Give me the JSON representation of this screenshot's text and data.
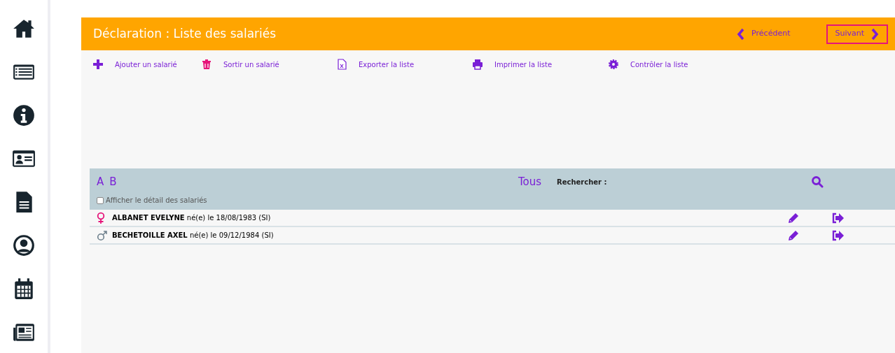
{
  "header": {
    "title": "Déclaration : Liste des salariés",
    "nav": [
      {
        "label": "Précédent",
        "kind": "prev",
        "highlighted": false
      },
      {
        "label": "Suivant",
        "kind": "next",
        "highlighted": true
      }
    ]
  },
  "toolbar": [
    {
      "label": "Ajouter un salarié"
    },
    {
      "label": "Sortir un salarié"
    },
    {
      "label": "Exporter la liste"
    },
    {
      "label": "Imprimer la liste"
    },
    {
      "label": "Contrôler la liste"
    }
  ],
  "filter": {
    "letters": [
      "A",
      "B"
    ],
    "all_label": "Tous",
    "search_label": "Rechercher :",
    "detail_checkbox": {
      "label": "Afficher le détail des salariés",
      "checked": false
    }
  },
  "employees": [
    {
      "text": "**ALBANET EVELYNE** né(e) le 18/08/1983 (SI)",
      "kind": "female"
    },
    {
      "text": "**BECHETOILLE AXEL** né(e) le 09/12/1984 (SI)",
      "kind": "male"
    }
  ]
}
